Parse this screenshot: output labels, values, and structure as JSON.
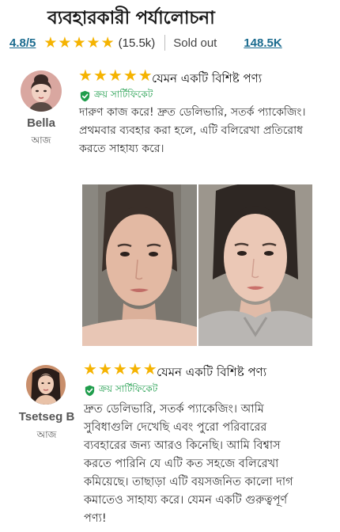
{
  "header": {
    "title": "ব্যবহারকারী পর্যালোচনা"
  },
  "summary": {
    "rating": "4.8/5",
    "stars": 5,
    "review_count": "(15.5k)",
    "sold_label": "Sold out",
    "sold_count": "148.5K"
  },
  "colors": {
    "star": "#f5b301",
    "link": "#1b6b8f",
    "verified": "#1f9d4c"
  },
  "reviews": [
    {
      "name": "Bella",
      "date": "আজ",
      "stars": 5,
      "headline": "যেমন একটি বিশিষ্ট পণ্য",
      "verified": "ক্রয় সার্টিফিকেট",
      "text_lines": [
        "দারুণ কাজ করে! দ্রুত ডেলিভারি, সতর্ক প্যাকেজিং।",
        "প্রথমবার ব্যবহার করা হলে, এটি বলিরেখা প্রতিরোধ",
        "করতে সাহায্য করে।"
      ],
      "has_photo": true
    },
    {
      "name": "Tsetseg B",
      "date": "আজ",
      "stars": 5,
      "headline": "যেমন একটি বিশিষ্ট পণ্য",
      "verified": "ক্রয় সার্টিফিকেট",
      "text_lines": [
        "দ্রুত ডেলিভারি, সতর্ক প্যাকেজিং। আমি",
        "সুবিধাগুলি দেখেছি এবং পুরো পরিবারের",
        "ব্যবহারের জন্য আরও কিনেছি। আমি বিশ্বাস",
        "করতে পারিনি যে এটি কত সহজে বলিরেখা",
        "কমিয়েছে। তাছাড়া এটি বয়সজনিত কালো দাগ",
        "কমাতেও সাহায্য করে। যেমন একটি গুরুত্বপূর্ণ",
        "পণ্য!"
      ],
      "has_photo": false
    }
  ]
}
